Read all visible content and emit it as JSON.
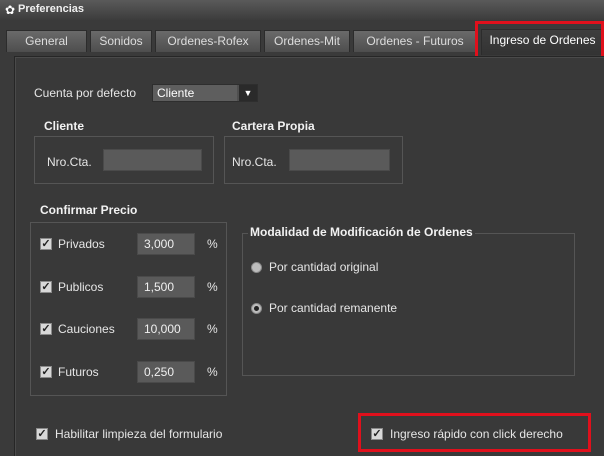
{
  "window": {
    "title": "Preferencias",
    "title_icon": "gear-icon"
  },
  "tabs": [
    {
      "label": "General",
      "active": false
    },
    {
      "label": "Sonidos",
      "active": false
    },
    {
      "label": "Ordenes-Rofex",
      "active": false
    },
    {
      "label": "Ordenes-Mit",
      "active": false
    },
    {
      "label": "Ordenes - Futuros",
      "active": false
    },
    {
      "label": "Ingreso de Ordenes",
      "active": true
    }
  ],
  "account": {
    "label": "Cuenta por defecto",
    "selected": "Cliente"
  },
  "cliente": {
    "title": "Cliente",
    "nro_label": "Nro.Cta.",
    "nro_value": ""
  },
  "cartera": {
    "title": "Cartera Propia",
    "nro_label": "Nro.Cta.",
    "nro_value": ""
  },
  "confirm": {
    "title": "Confirmar Precio",
    "rows": [
      {
        "label": "Privados",
        "checked": true,
        "value": "3,000",
        "unit": "%"
      },
      {
        "label": "Publicos",
        "checked": true,
        "value": "1,500",
        "unit": "%"
      },
      {
        "label": "Cauciones",
        "checked": true,
        "value": "10,000",
        "unit": "%"
      },
      {
        "label": "Futuros",
        "checked": true,
        "value": "0,250",
        "unit": "%"
      }
    ]
  },
  "modalidad": {
    "title": "Modalidad de Modificación de Ordenes",
    "options": [
      {
        "label": "Por cantidad original",
        "selected": false
      },
      {
        "label": "Por cantidad remanente",
        "selected": true
      }
    ]
  },
  "bottom": {
    "clear_label": "Habilitar limpieza del formulario",
    "clear_checked": true,
    "quick_label": "Ingreso rápido con click derecho",
    "quick_checked": true
  },
  "colors": {
    "highlight": "#e0101c",
    "panel": "#393939"
  }
}
